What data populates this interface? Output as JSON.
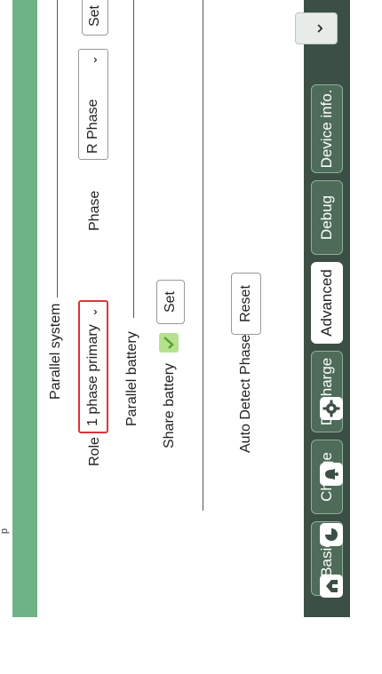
{
  "page": {
    "stray_text": "p"
  },
  "parallel_system": {
    "section_label": "Parallel system",
    "role_label": "Role",
    "role_value": "1 phase primary",
    "phase_label": "Phase",
    "phase_value": "R Phase",
    "set_label": "Set"
  },
  "parallel_battery": {
    "section_label": "Parallel battery",
    "share_label": "Share battery",
    "share_checked": true,
    "set_label": "Set"
  },
  "auto_detect": {
    "label": "Auto Detect Phase",
    "reset_label": "Reset"
  },
  "tabs": [
    {
      "label": "Basic",
      "active": false
    },
    {
      "label": "Charge",
      "active": false
    },
    {
      "label": "Discharge",
      "active": false
    },
    {
      "label": "Advanced",
      "active": true
    },
    {
      "label": "Debug",
      "active": false
    },
    {
      "label": "Device info.",
      "active": false
    }
  ],
  "nav_icons": [
    "home-icon",
    "pie-chart-icon",
    "alarm-bell-icon",
    "settings-gear-icon"
  ],
  "colors": {
    "background": "#6db385",
    "tab_bar": "#3c4f44",
    "tab": "#4f6b5a",
    "highlight": "#e0333a",
    "check": "#b6e28f"
  }
}
